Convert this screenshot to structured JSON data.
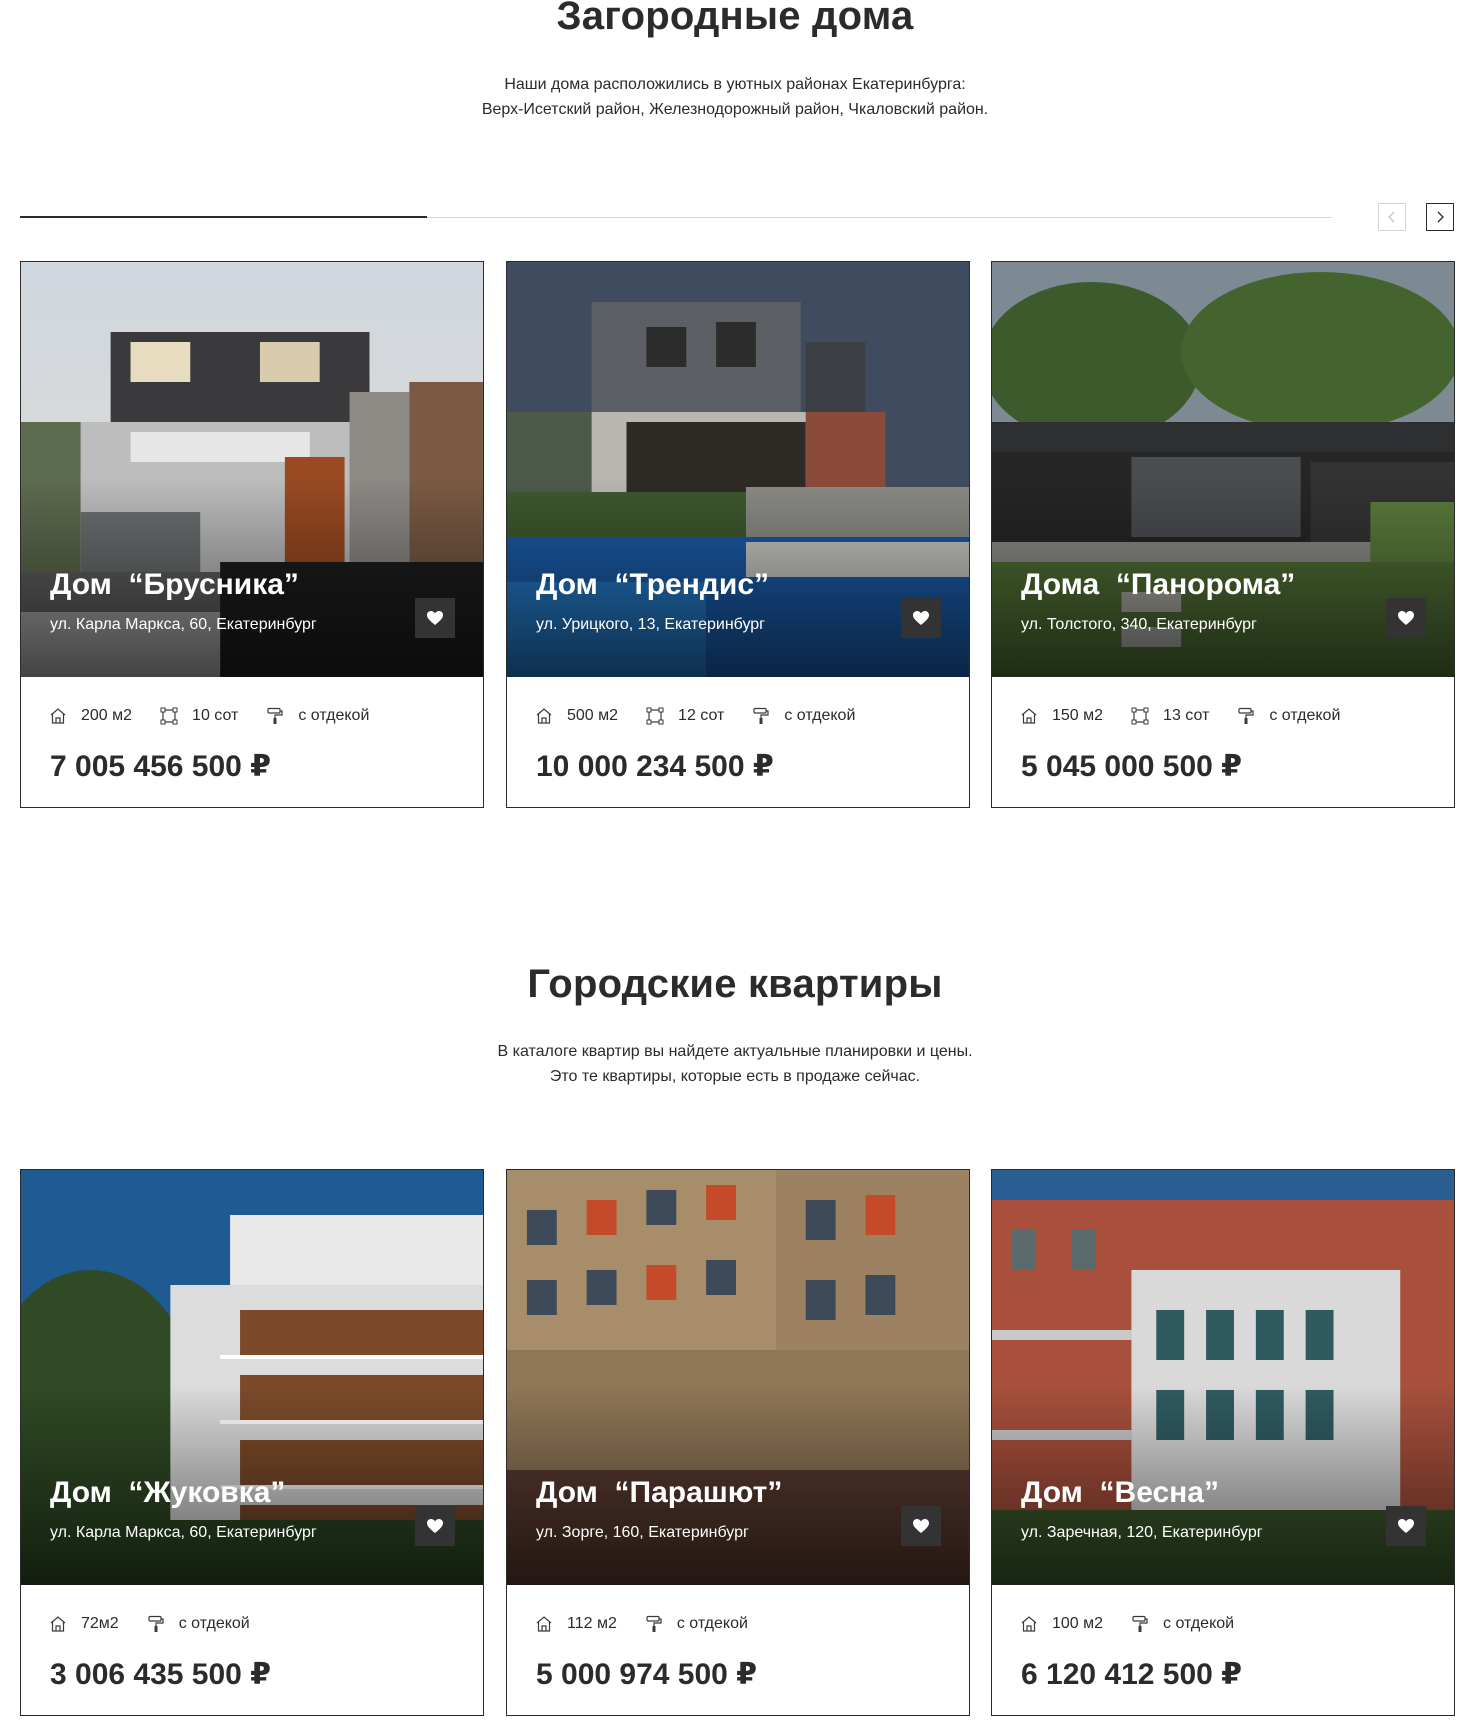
{
  "houses": {
    "title": "Загородные дома",
    "subtitle_line1": "Наши дома расположились в уютных районах Екатеринбурга:",
    "subtitle_line2": "Верх-Исетский район, Железнодорожный район, Чкаловский район.",
    "slider_progress": 0.31,
    "cards": [
      {
        "title": "Дом  “Брусника”",
        "address": "ул. Карла Маркса, 60, Екатеринбург",
        "area": "200 м2",
        "plot": "10 сот",
        "finish": "с отдекой",
        "price": "7 005 456 500 ₽"
      },
      {
        "title": "Дом  “Трендис”",
        "address": "ул. Урицкого, 13, Екатеринбург",
        "area": "500 м2",
        "plot": "12 сот",
        "finish": "с отдекой",
        "price": "10 000 234 500 ₽"
      },
      {
        "title": "Дома  “Панорома”",
        "address": " ул. Толстого, 340, Екатеринбург",
        "area": "150 м2",
        "plot": "13 сот",
        "finish": "с отдекой",
        "price": "5 045 000 500 ₽"
      }
    ]
  },
  "apartments": {
    "title": "Городские квартиры",
    "subtitle_line1": "В каталоге квартир вы найдете актуальные планировки и цены.",
    "subtitle_line2": "Это те квартиры, которые есть в продаже сейчас.",
    "cards": [
      {
        "title": "Дом  “Жуковка”",
        "address": "ул. Карла Маркса, 60, Екатеринбург",
        "area": "72м2",
        "finish": "с отдекой",
        "price": "3 006 435 500 ₽"
      },
      {
        "title": "Дом  “Парашют”",
        "address": "ул. Зорге, 160, Екатеринбург",
        "area": "112 м2",
        "finish": "с отдекой",
        "price": "5 000 974 500 ₽"
      },
      {
        "title": "Дом  “Весна”",
        "address": " ул. Заречная, 120, Екатеринбург",
        "area": "100 м2",
        "finish": "с отдекой",
        "price": "6 120 412 500 ₽"
      }
    ]
  },
  "icons": {
    "area": "house-icon",
    "plot": "plot-corners-icon",
    "finish": "paint-roller-icon",
    "favorite": "heart-icon",
    "prev": "chevron-left-icon",
    "next": "chevron-right-icon"
  },
  "colors": {
    "text": "#2b2b2b",
    "favorite_bg": "#333333",
    "border": "#2b2b2b"
  }
}
